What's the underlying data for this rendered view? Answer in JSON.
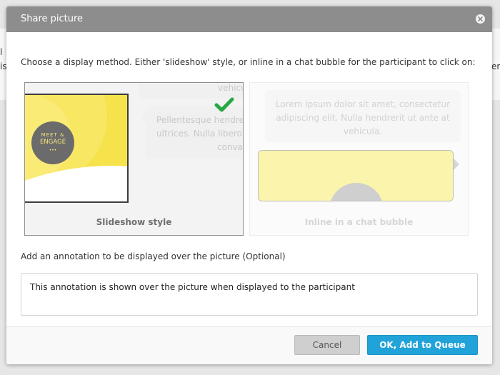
{
  "background": {
    "left_fragments": [
      "l",
      "is"
    ],
    "right_fragment": "er"
  },
  "dialog": {
    "title": "Share picture",
    "close_icon": "close-icon",
    "instruction": "Choose a display method. Either 'slideshow' style, or inline in a chat bubble for the participant to click on:",
    "options": [
      {
        "label": "Slideshow style",
        "selected": true,
        "bubble_top_text": "vehicu",
        "bubble_text": [
          "Pellentesque hendre",
          "ultrices. Nulla libero",
          "conva"
        ],
        "logo": {
          "line1": "MEET &",
          "line2": "ENGAGE",
          "dots": "•••"
        }
      },
      {
        "label": "Inline in a chat bubble",
        "selected": false,
        "bubble_text": [
          "Lorem ipsum dolor sit amet, consectetur",
          "adipiscing elit. Nulla hendrerit ut ante at",
          "vehicula."
        ]
      }
    ],
    "annotation_label": "Add an annotation to be displayed over the picture (Optional)",
    "annotation_value": "This annotation is shown over the picture when displayed to the participant",
    "buttons": {
      "cancel": "Cancel",
      "ok": "OK, Add to Queue"
    }
  },
  "colors": {
    "header": "#8d8d8d",
    "primary_button": "#21a3d9",
    "check": "#27a844",
    "image_yellow": "#f6e24a"
  }
}
